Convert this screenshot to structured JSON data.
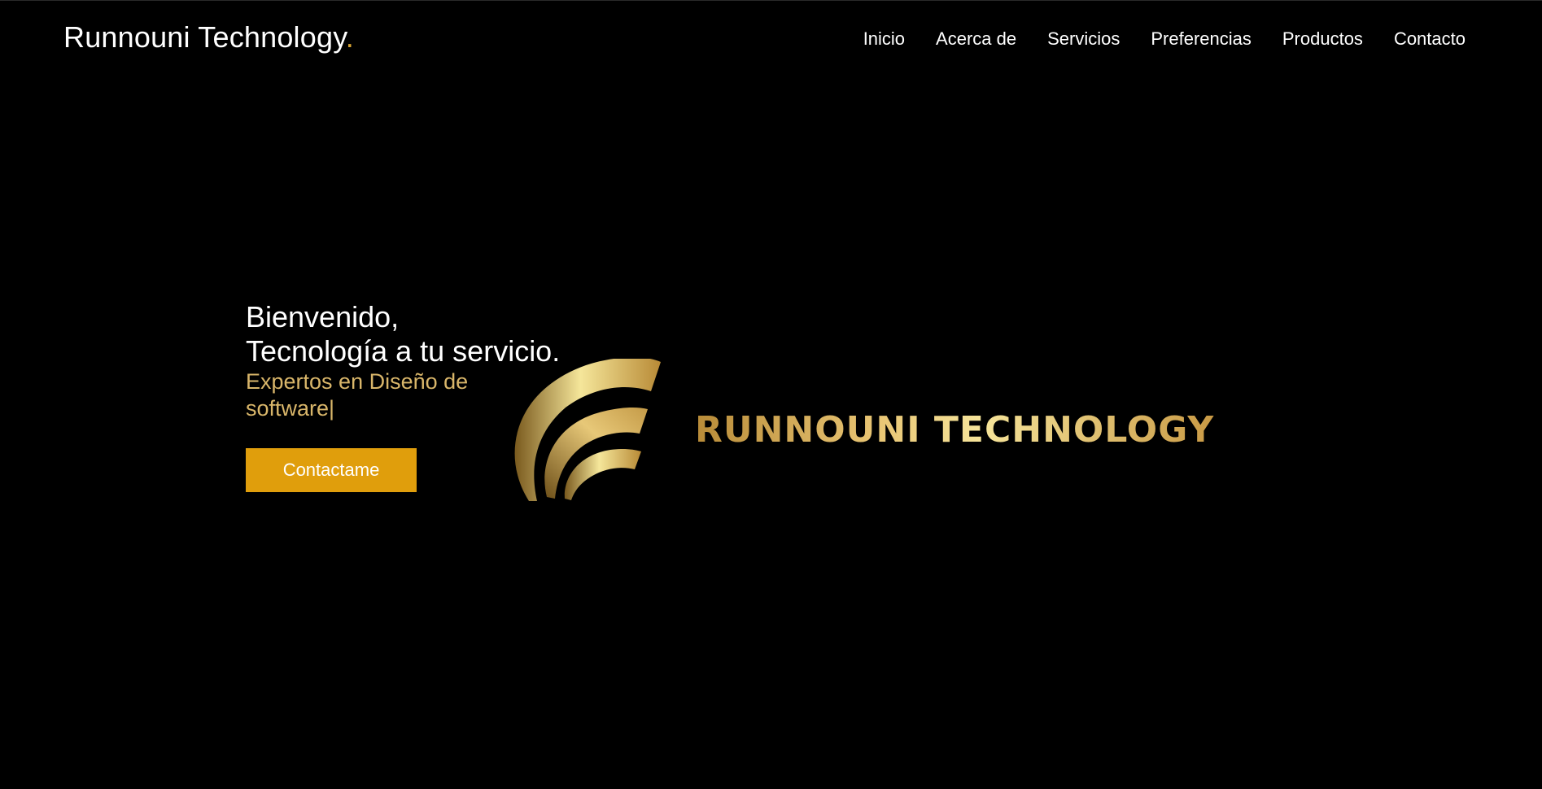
{
  "header": {
    "brand_name": "Runnouni Technology",
    "brand_dot": ".",
    "nav": [
      {
        "label": "Inicio"
      },
      {
        "label": "Acerca de"
      },
      {
        "label": "Servicios"
      },
      {
        "label": "Preferencias"
      },
      {
        "label": "Productos"
      },
      {
        "label": "Contacto"
      }
    ]
  },
  "hero": {
    "line1": "Bienvenido,",
    "line2": "Tecnología a tu servicio.",
    "subtitle": "Expertos en Diseño de software",
    "cursor": "|",
    "cta_label": "Contactame"
  },
  "logo": {
    "text": "RUNNOUNI TECHNOLOGY"
  },
  "colors": {
    "background": "#000000",
    "accent": "#e09e0c",
    "subtitle": "#d9b66a",
    "gold": "#d9a532"
  }
}
